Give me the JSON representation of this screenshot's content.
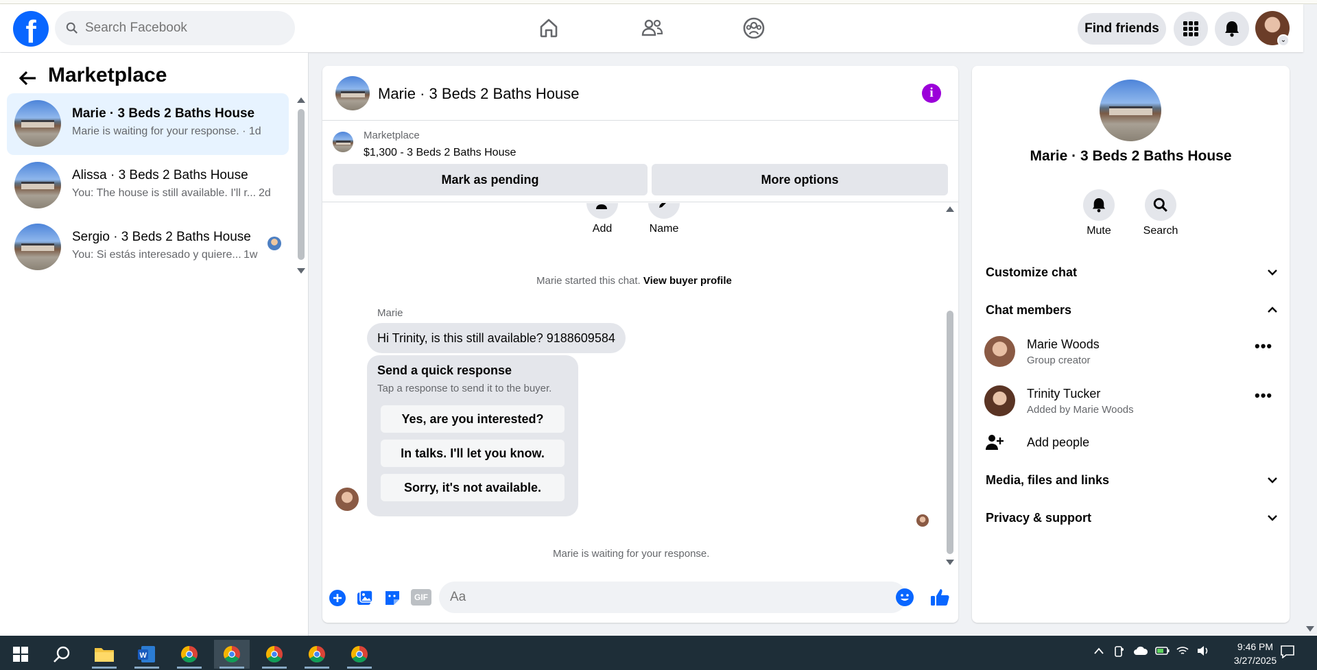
{
  "header": {
    "logo": "f",
    "search_placeholder": "Search Facebook",
    "find_friends": "Find friends",
    "icons": [
      "home-icon",
      "friends-icon",
      "groups-icon",
      "menu-grid-icon",
      "bell-icon"
    ]
  },
  "left": {
    "title": "Marketplace",
    "conversations": [
      {
        "name": "Marie · 3 Beds 2 Baths House",
        "preview": "Marie is waiting for your response. · 1d",
        "time": ""
      },
      {
        "name": "Alissa · 3 Beds 2 Baths House",
        "preview": "You: The house is still available. I'll r...",
        "time": "2d"
      },
      {
        "name": "Sergio · 3 Beds 2 Baths House",
        "preview": "You: Si estás interesado y quiere...",
        "time": "1w"
      }
    ]
  },
  "chat": {
    "title": "Marie · 3 Beds 2 Baths House",
    "marketplace_label": "Marketplace",
    "listing": "$1,300 - 3 Beds 2 Baths House",
    "mark_pending": "Mark as pending",
    "more_options": "More options",
    "add_label": "Add",
    "name_label": "Name",
    "started": "Marie started this chat.",
    "view_profile": "View buyer profile",
    "sender": "Marie",
    "message": "Hi Trinity, is this still available? 9188609584",
    "quick_title": "Send a quick response",
    "quick_sub": "Tap a response to send it to the buyer.",
    "quick_options": [
      "Yes, are you interested?",
      "In talks. I'll let you know.",
      "Sorry, it's not available."
    ],
    "waiting": "Marie is waiting for your response.",
    "composer_placeholder": "Aa",
    "gif": "GIF"
  },
  "info": {
    "title": "Marie · 3 Beds 2 Baths House",
    "mute": "Mute",
    "search": "Search",
    "customize": "Customize chat",
    "members_title": "Chat members",
    "members": [
      {
        "name": "Marie Woods",
        "role": "Group creator"
      },
      {
        "name": "Trinity Tucker",
        "role": "Added by Marie Woods"
      }
    ],
    "add_people": "Add people",
    "media": "Media, files and links",
    "privacy": "Privacy & support"
  },
  "taskbar": {
    "time": "9:46 PM",
    "date": "3/27/2025"
  },
  "colors": {
    "brand": "#0866ff",
    "info": "#9b00d9",
    "active_conv": "#e7f3ff"
  }
}
